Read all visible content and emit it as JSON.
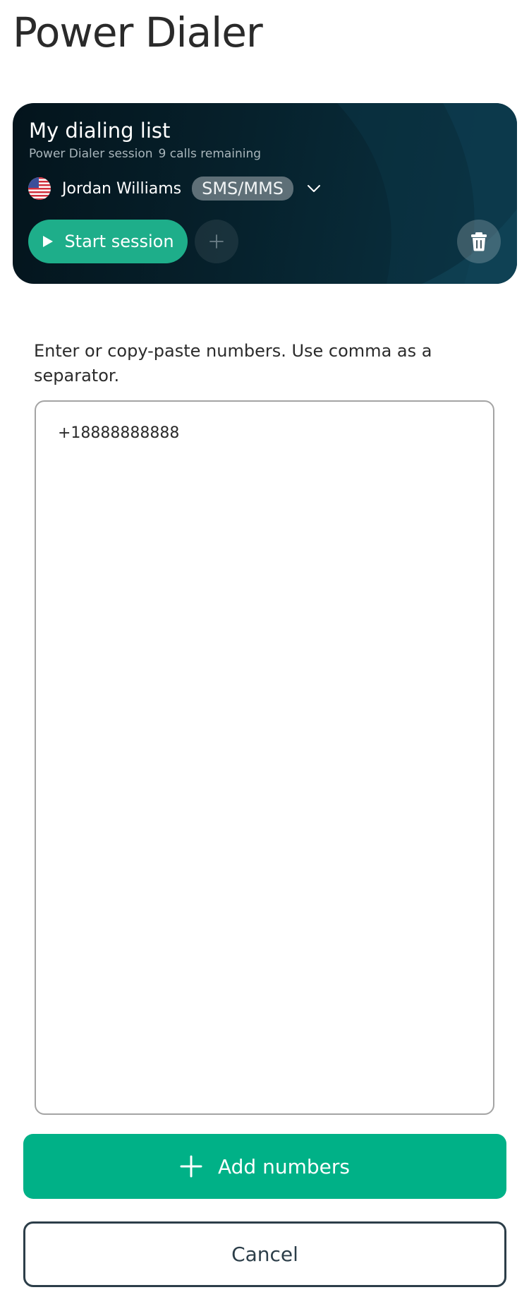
{
  "page": {
    "title": "Power Dialer"
  },
  "session_card": {
    "title": "My dialing list",
    "subtitle": "Power Dialer session",
    "calls_remaining": "9 calls remaining",
    "caller": {
      "name": "Jordan Williams",
      "flag_icon": "us-flag-icon",
      "channel": "SMS/MMS"
    },
    "start_label": "Start session"
  },
  "numbers": {
    "instructions": "Enter or copy-paste numbers. Use comma as a separator.",
    "value": "+18888888888",
    "placeholder": ""
  },
  "actions": {
    "add_label": "Add numbers",
    "cancel_label": "Cancel"
  },
  "colors": {
    "accent": "#00b187",
    "start_button": "#1eae8a",
    "card_background": "#06212c",
    "cancel_border": "#2c3e49"
  }
}
